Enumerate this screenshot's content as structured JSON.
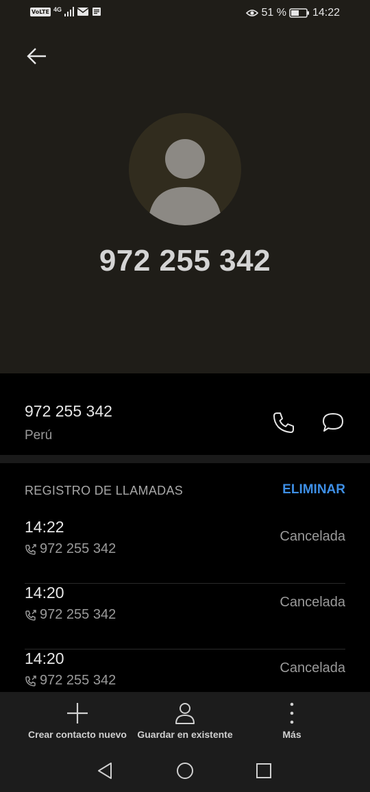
{
  "status_bar": {
    "volte": "VoLTE",
    "network": "4G",
    "battery_percent": "51 %",
    "time": "14:22"
  },
  "contact": {
    "display_number": "972 255 342",
    "number": "972 255 342",
    "country": "Perú"
  },
  "call_log": {
    "header": "REGISTRO DE LLAMADAS",
    "delete_label": "ELIMINAR",
    "items": [
      {
        "time": "14:22",
        "number": "972 255 342",
        "status": "Cancelada"
      },
      {
        "time": "14:20",
        "number": "972 255 342",
        "status": "Cancelada"
      },
      {
        "time": "14:20",
        "number": "972 255 342",
        "status": "Cancelada"
      }
    ]
  },
  "actions": {
    "create": "Crear contacto nuevo",
    "save": "Guardar en existente",
    "more": "Más"
  },
  "colors": {
    "header_bg": "#1f1d18",
    "accent": "#3e8fe6",
    "avatar_bg": "#312c1e"
  },
  "icons": {
    "back": "arrow-left-icon",
    "call": "phone-icon",
    "message": "chat-bubble-icon",
    "add": "plus-icon",
    "person": "person-icon",
    "more": "more-vertical-icon"
  }
}
